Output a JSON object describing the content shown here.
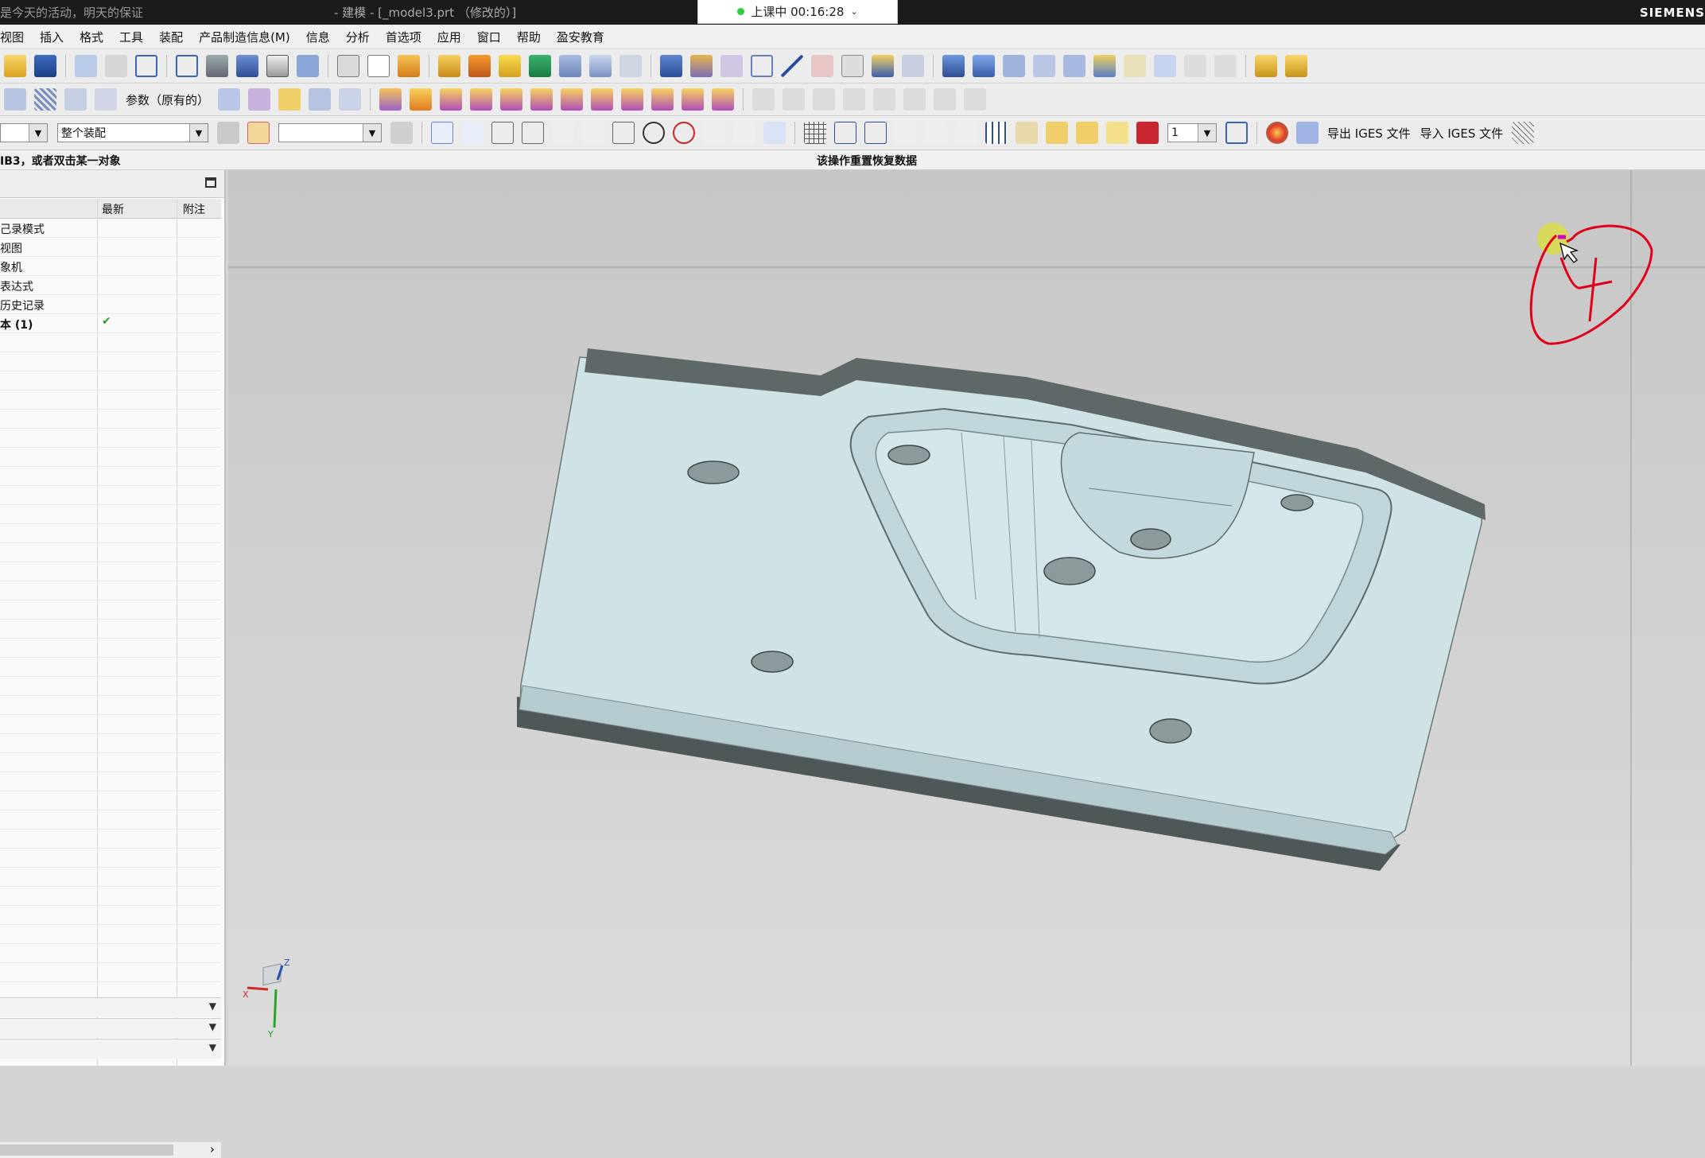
{
  "titlebar": {
    "notice": "是今天的活动，明天的保证",
    "window_title": "- 建模 - [_model3.prt （修改的）]",
    "brand": "SIEMENS"
  },
  "timer": {
    "label": "上课中 00:16:28"
  },
  "menu": [
    "视图",
    "插入",
    "格式",
    "工具",
    "装配",
    "产品制造信息(M)",
    "信息",
    "分析",
    "首选项",
    "应用",
    "窗口",
    "帮助",
    "盈安教育"
  ],
  "toolbar2": {
    "param_label": "参数（原有的）"
  },
  "toolbar3": {
    "scope_value": "整个装配",
    "filter_value": "",
    "layer_value": "1",
    "export_iges": "导出 IGES 文件",
    "import_iges": "导入 IGES 文件"
  },
  "cue_line": {
    "cue": "IB3，或者双击某一对象",
    "status": "该操作重置恢复数据"
  },
  "navigator": {
    "columns": [
      "最新",
      "附注"
    ],
    "rows": [
      {
        "name": "己录模式",
        "latest": false
      },
      {
        "name": "视图",
        "latest": false
      },
      {
        "name": "象机",
        "latest": false
      },
      {
        "name": "表达式",
        "latest": false
      },
      {
        "name": "历史记录",
        "latest": false
      },
      {
        "name": "本 (1)",
        "latest": true
      }
    ],
    "checkmark": "✔"
  },
  "triad": {
    "x": "X",
    "y": "Y",
    "z": "Z"
  },
  "annotation": {
    "color": "#e0001a",
    "pen_color": "#d400c8",
    "cursor_highlight": "#e6e600"
  },
  "colors": {
    "part_face": "#cfe3e6",
    "part_side": "#4d5656",
    "viewport_bg": "#d2d2d2"
  }
}
